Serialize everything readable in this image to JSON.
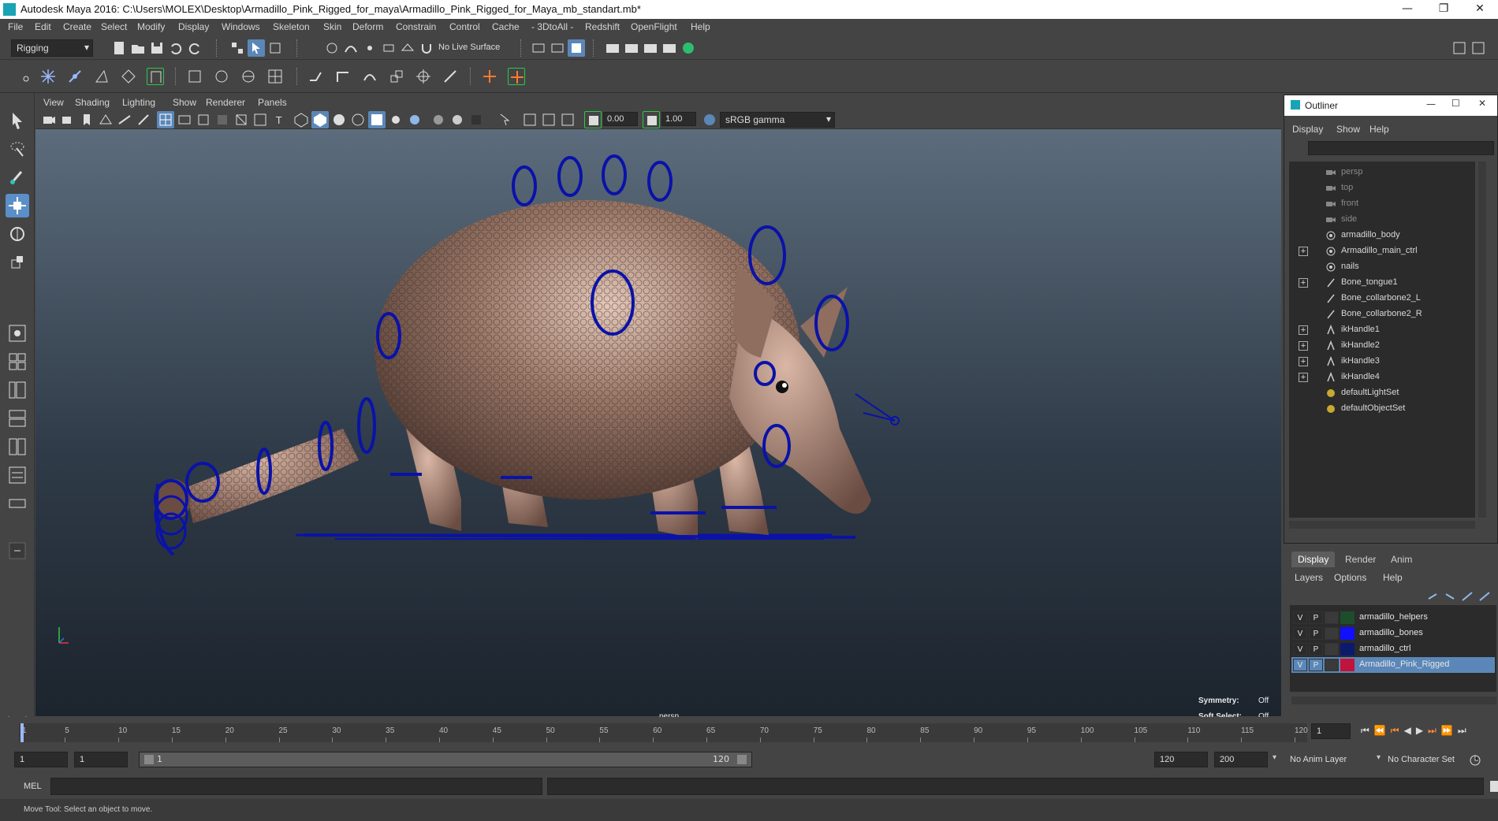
{
  "window": {
    "title": "Autodesk Maya 2016: C:\\Users\\MOLEX\\Desktop\\Armadillo_Pink_Rigged_for_maya\\Armadillo_Pink_Rigged_for_Maya_mb_standart.mb*",
    "minimize": "—",
    "restore": "❐",
    "close": "✕"
  },
  "menubar": [
    "File",
    "Edit",
    "Create",
    "Select",
    "Modify",
    "Display",
    "Windows",
    "Skeleton",
    "Skin",
    "Deform",
    "Constrain",
    "Control",
    "Cache",
    "- 3DtoAll -",
    "Redshift",
    "OpenFlight",
    "Help"
  ],
  "statusline": {
    "menuset": "Rigging",
    "live_surface": "No Live Surface"
  },
  "viewport": {
    "menu": [
      "View",
      "Shading",
      "Lighting",
      "Show",
      "Renderer",
      "Panels"
    ],
    "exposure": "0.00",
    "gamma": "1.00",
    "colorspace": "sRGB gamma",
    "camera_label": "persp",
    "symmetry_label": "Symmetry:",
    "symmetry_value": "Off",
    "softselect_label": "Soft Select:",
    "softselect_value": "Off"
  },
  "outliner": {
    "title": "Outliner",
    "menu": [
      "Display",
      "Show",
      "Help"
    ],
    "items": [
      {
        "label": "persp",
        "icon": "camera-icon",
        "dim": true,
        "expand": false
      },
      {
        "label": "top",
        "icon": "camera-icon",
        "dim": true,
        "expand": false
      },
      {
        "label": "front",
        "icon": "camera-icon",
        "dim": true,
        "expand": false
      },
      {
        "label": "side",
        "icon": "camera-icon",
        "dim": true,
        "expand": false
      },
      {
        "label": "armadillo_body",
        "icon": "mesh-icon",
        "dim": false,
        "expand": false
      },
      {
        "label": "Armadillo_main_ctrl",
        "icon": "mesh-icon",
        "dim": false,
        "expand": true
      },
      {
        "label": "nails",
        "icon": "mesh-icon",
        "dim": false,
        "expand": false
      },
      {
        "label": "Bone_tongue1",
        "icon": "joint-icon",
        "dim": false,
        "expand": true
      },
      {
        "label": "Bone_collarbone2_L",
        "icon": "joint-icon",
        "dim": false,
        "expand": false
      },
      {
        "label": "Bone_collarbone2_R",
        "icon": "joint-icon",
        "dim": false,
        "expand": false
      },
      {
        "label": "ikHandle1",
        "icon": "ikhandle-icon",
        "dim": false,
        "expand": true
      },
      {
        "label": "ikHandle2",
        "icon": "ikhandle-icon",
        "dim": false,
        "expand": true
      },
      {
        "label": "ikHandle3",
        "icon": "ikhandle-icon",
        "dim": false,
        "expand": true
      },
      {
        "label": "ikHandle4",
        "icon": "ikhandle-icon",
        "dim": false,
        "expand": true
      },
      {
        "label": "defaultLightSet",
        "icon": "set-icon",
        "dim": false,
        "expand": false
      },
      {
        "label": "defaultObjectSet",
        "icon": "set-icon",
        "dim": false,
        "expand": false
      }
    ]
  },
  "layer_editor": {
    "tabs": [
      "Display",
      "Render",
      "Anim"
    ],
    "menu": [
      "Layers",
      "Options",
      "Help"
    ],
    "layers": [
      {
        "v": "V",
        "p": "P",
        "color": "#1e4d2b",
        "name": "armadillo_helpers",
        "selected": false
      },
      {
        "v": "V",
        "p": "P",
        "color": "#1010ff",
        "name": "armadillo_bones",
        "selected": false
      },
      {
        "v": "V",
        "p": "P",
        "color": "#0c1a6e",
        "name": "armadillo_ctrl",
        "selected": false
      },
      {
        "v": "V",
        "p": "P",
        "color": "#c0143c",
        "name": "Armadillo_Pink_Rigged",
        "selected": true
      }
    ]
  },
  "timeslider": {
    "ticks": [
      "1",
      "5",
      "10",
      "15",
      "20",
      "25",
      "30",
      "35",
      "40",
      "45",
      "50",
      "55",
      "60",
      "65",
      "70",
      "75",
      "80",
      "85",
      "90",
      "95",
      "100",
      "105",
      "110",
      "115",
      "120"
    ],
    "current_frame": "1"
  },
  "rangeslider": {
    "start": "1",
    "playback_start": "1",
    "range_start": "1",
    "range_end": "120",
    "playback_end": "120",
    "end": "200",
    "anim_layer": "No Anim Layer",
    "character_set": "No Character Set"
  },
  "cmdline": {
    "label": "MEL"
  },
  "helpline": {
    "text": "Move Tool: Select an object to move."
  },
  "colors": {
    "accent": "#5b87b8",
    "rig_blue": "#0a12a8"
  }
}
